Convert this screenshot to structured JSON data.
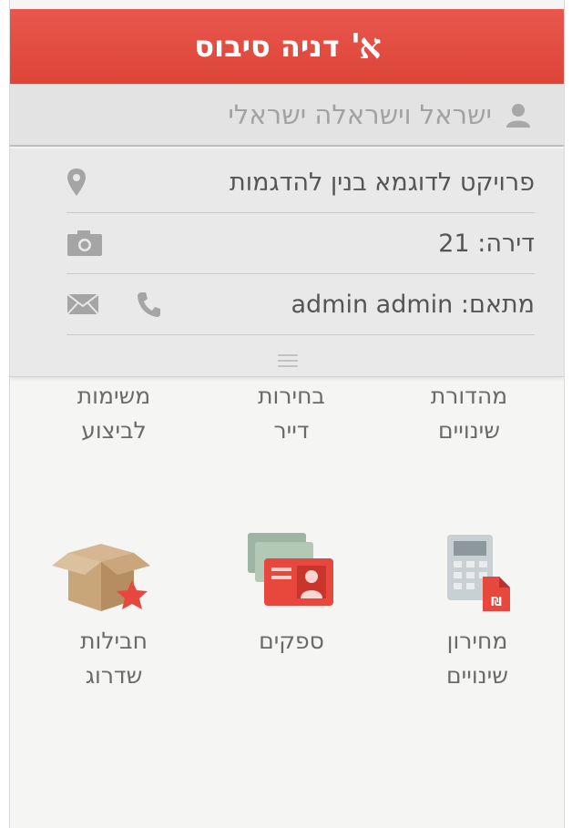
{
  "header": {
    "logo": "א'",
    "title": "דניה סיבוס"
  },
  "user": {
    "name": "ישראל וישראלה ישראלי",
    "icon": "user-icon"
  },
  "info": {
    "project": "פרויקט לדוגמא בנין להדגמות",
    "apartment": "דירה: 21",
    "coordinator": "מתאם: admin admin"
  },
  "grid": {
    "row1": [
      {
        "line1": "מהדורת",
        "line2": "שינויים"
      },
      {
        "line1": "בחירות",
        "line2": "דייר"
      },
      {
        "line1": "משימות",
        "line2": "לביצוע"
      }
    ],
    "row2": [
      {
        "line1": "מחירון",
        "line2": "שינויים"
      },
      {
        "line1": "ספקים",
        "line2": ""
      },
      {
        "line1": "חבילות",
        "line2": "שדרוג"
      }
    ]
  },
  "colors": {
    "header_red": "#e04a3f",
    "accent_red": "#e8473e",
    "text_gray": "#6a6a6a"
  }
}
